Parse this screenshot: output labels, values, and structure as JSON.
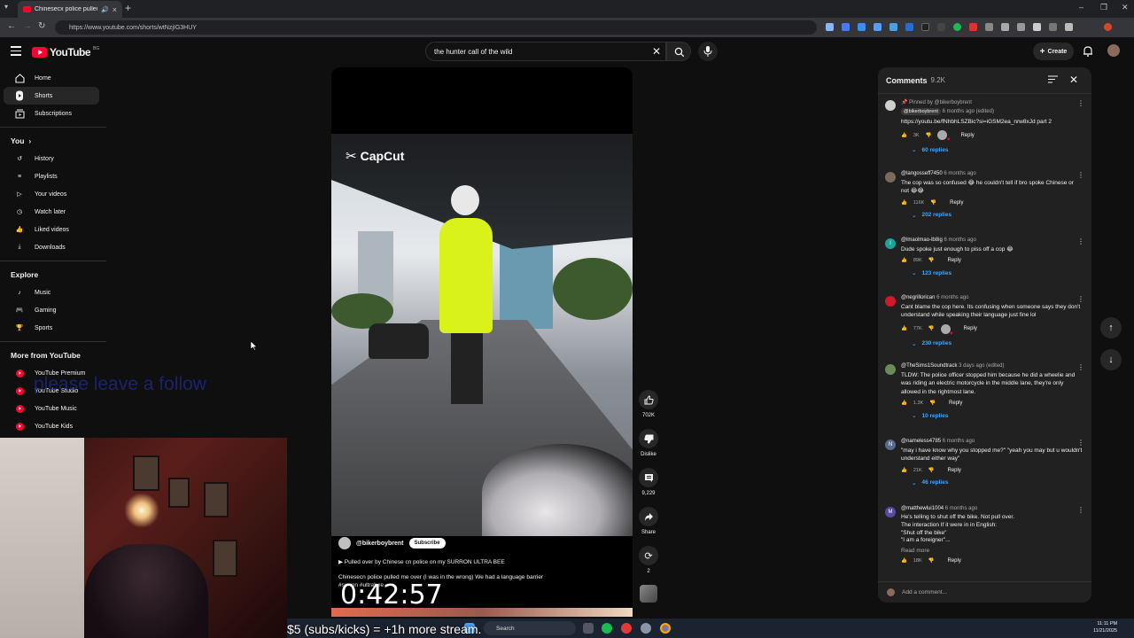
{
  "browser": {
    "tab_title": "Chinesecx police pulled me",
    "url": "https://www.youtube.com/shorts/wtNzjIG3HUY"
  },
  "header": {
    "logo_text": "YouTube",
    "country_code": "BG",
    "search_value": "the hunter call of the wild",
    "create_label": "Create"
  },
  "sidebar": {
    "main": [
      {
        "label": "Home",
        "icon": "home-icon"
      },
      {
        "label": "Shorts",
        "icon": "shorts-icon"
      },
      {
        "label": "Subscriptions",
        "icon": "subscriptions-icon"
      }
    ],
    "you_heading": "You",
    "you": [
      {
        "label": "History",
        "icon": "history-icon"
      },
      {
        "label": "Playlists",
        "icon": "playlists-icon"
      },
      {
        "label": "Your videos",
        "icon": "your-videos-icon"
      },
      {
        "label": "Watch later",
        "icon": "watch-later-icon"
      },
      {
        "label": "Liked videos",
        "icon": "liked-videos-icon"
      },
      {
        "label": "Downloads",
        "icon": "downloads-icon"
      }
    ],
    "explore_heading": "Explore",
    "explore": [
      {
        "label": "Music",
        "icon": "music-icon"
      },
      {
        "label": "Gaming",
        "icon": "gaming-icon"
      },
      {
        "label": "Sports",
        "icon": "sports-icon"
      }
    ],
    "more_heading": "More from YouTube",
    "more": [
      {
        "label": "YouTube Premium"
      },
      {
        "label": "YouTube Studio"
      },
      {
        "label": "YouTube Music"
      },
      {
        "label": "YouTube Kids"
      }
    ]
  },
  "overlay": {
    "follow_text": "please leave a follow",
    "timer": "0:42:57",
    "stream_text": "$5 (subs/kicks) = +1h more stream."
  },
  "short": {
    "watermark": "CapCut",
    "channel": "@bikerboybrent",
    "subscribe_label": "Subscribe",
    "link_text": "Pulled over by Chinese cn police on my SURRON ULTRA BEE",
    "description": "Chinesecn police pulled me over (I was in the wrong) We had a language barrier #surron #ultrabee",
    "likes": "702K",
    "dislike_label": "Dislike",
    "comments_count": "9,229",
    "share_label": "Share",
    "remix_count": "2"
  },
  "comments": {
    "title": "Comments",
    "count": "9.2K",
    "add_placeholder": "Add a comment...",
    "items": [
      {
        "pinned": "Pinned by @bikerboybrent",
        "author": "@bikerboybrent",
        "time": "6 months ago (edited)",
        "text": "https://youtu.be/fNhbhLSZBic?si=iGSM2ea_nrw8xJd part 2",
        "likes": "3K",
        "reply_label": "Reply",
        "replies": "60 replies",
        "avatar_color": "#cfcfcf",
        "creator_heart": true
      },
      {
        "author": "@langosseff7450",
        "time": "6 months ago",
        "text": "The cop was so confused 😂 he couldn't tell if bro spoke Chinese or not 😂😂",
        "likes": "116K",
        "reply_label": "Reply",
        "replies": "202 replies",
        "avatar_color": "#7a6a5a"
      },
      {
        "author": "@lmaolmao-lb8ig",
        "time": "6 months ago",
        "text": "Dude spoke just enough to piss off a cop 😂",
        "likes": "89K",
        "reply_label": "Reply",
        "replies": "123 replies",
        "avatar_letter": "l",
        "avatar_color": "#1aa39a"
      },
      {
        "author": "@negrillorican",
        "time": "6 months ago",
        "text": "Cant blame the cop here. Its confusing when someone says they don't understand while speaking their language just fine lol",
        "likes": "77K",
        "reply_label": "Reply",
        "replies": "230 replies",
        "avatar_color": "#d01a2a",
        "creator_heart": true
      },
      {
        "author": "@TheSims1Soundtrack",
        "time": "3 days ago (edited)",
        "text": "TLDW: The police officer stopped him because he did a wheelie and was riding an electric motorcycle in the middle lane, they're only allowed in the rightmost lane.",
        "likes": "1.3K",
        "reply_label": "Reply",
        "replies": "10 replies",
        "avatar_color": "#6a8a5a"
      },
      {
        "author": "@nameless4785",
        "time": "6 months ago",
        "text": "\"may i have know why you stopped me?\" \"yeah you may but u wouldn't understand either way\"",
        "likes": "21K",
        "reply_label": "Reply",
        "replies": "46 replies",
        "avatar_letter": "N",
        "avatar_color": "#5a6a8a"
      },
      {
        "author": "@matthewlui1004",
        "time": "6 months ago",
        "lines": [
          "He's telling to shut off the bike. Not pull over.",
          "The interaction If it were in in English:",
          "\"Shut off the bike\"",
          "\"I am a foreigner\"..."
        ],
        "read_more": "Read more",
        "likes": "18K",
        "reply_label": "Reply",
        "avatar_letter": "M",
        "avatar_color": "#5a4aa8"
      }
    ]
  },
  "taskbar": {
    "search_label": "Search",
    "time": "11:11 PM",
    "date": "11/21/2025"
  },
  "colors": {
    "accent": "#ff0033",
    "link": "#3ea6ff",
    "background": "#0f0f0f"
  }
}
